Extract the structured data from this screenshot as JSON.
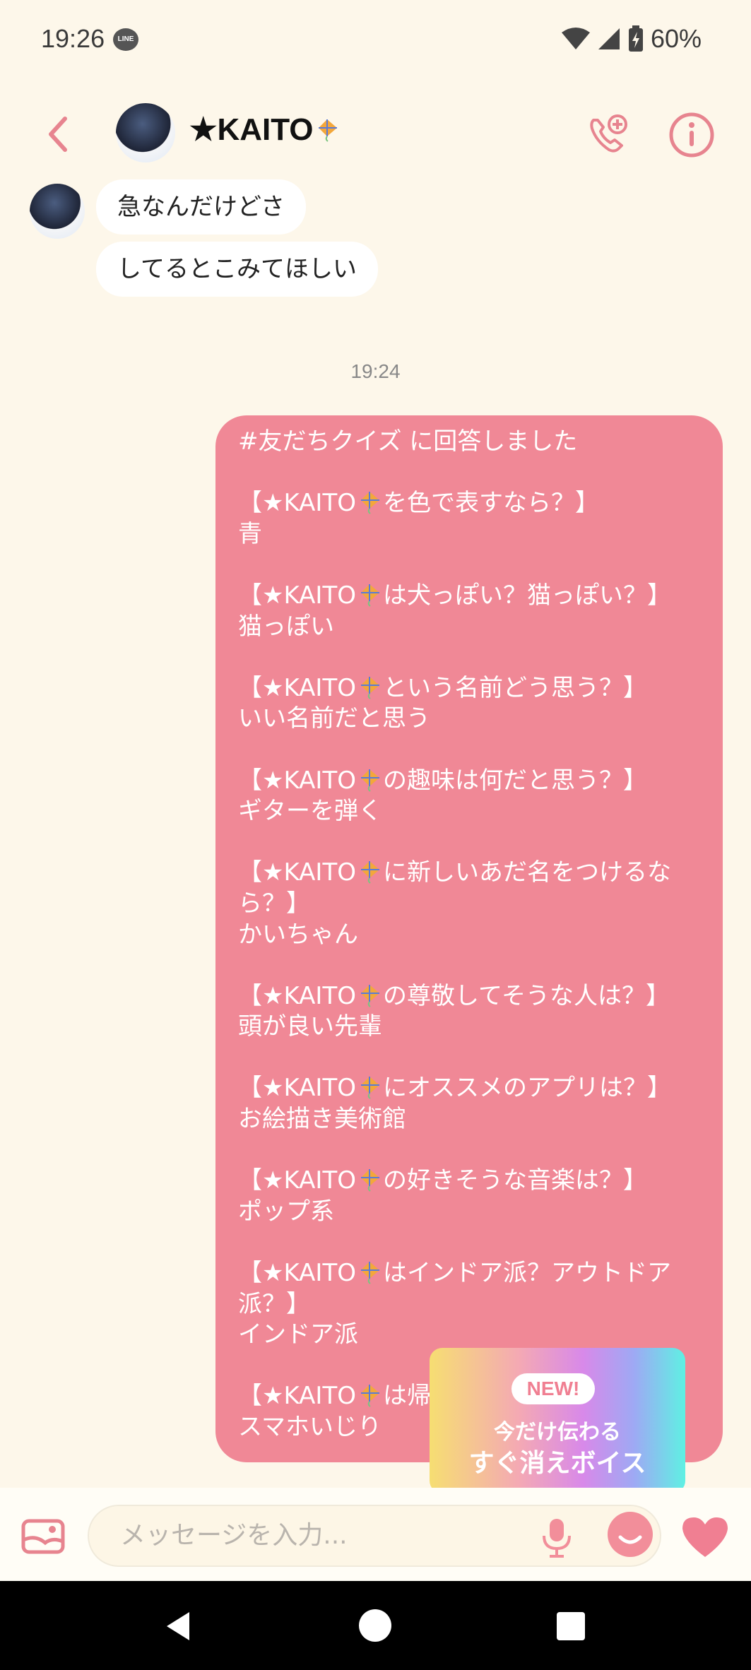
{
  "status_bar": {
    "time": "19:26",
    "app_badge": "LINE",
    "battery": "60%"
  },
  "header": {
    "contact_name": "★KAITO"
  },
  "incoming_messages": [
    "急なんだけどさ",
    "してるとこみてほしい"
  ],
  "timestamp": "19:24",
  "outgoing_message": {
    "lines": [
      "#友だちクイズ に回答しました",
      "",
      "【★KAITO{kite}を色で表すなら？】",
      "青",
      "",
      "【★KAITO{kite}は犬っぽい？猫っぽい？】",
      "猫っぽい",
      "",
      "【★KAITO{kite}という名前どう思う？】",
      "いい名前だと思う",
      "",
      "【★KAITO{kite}の趣味は何だと思う？】",
      "ギターを弾く",
      "",
      "【★KAITO{kite}に新しいあだ名をつけるな",
      "ら？】",
      "かいちゃん",
      "",
      "【★KAITO{kite}の尊敬してそうな人は？】",
      "頭が良い先輩",
      "",
      "【★KAITO{kite}にオススメのアプリは？】",
      "お絵描き美術館",
      "",
      "【★KAITO{kite}の好きそうな音楽は？】",
      "ポップ系",
      "",
      "【★KAITO{kite}はインドア派？アウトドア",
      "派？】",
      "インドア派",
      "",
      "【★KAITO{kite}は帰",
      "スマホいじり"
    ]
  },
  "promo": {
    "badge": "NEW!",
    "line1": "今だけ伝わる",
    "line2": "すぐ消えボイス"
  },
  "input": {
    "placeholder": "メッセージを入力..."
  },
  "colors": {
    "accent": "#f08896",
    "background": "#fdf7ea",
    "incoming_bubble": "#ffffff"
  },
  "icons": [
    "back-arrow-icon",
    "voice-call-icon",
    "info-icon",
    "gallery-icon",
    "mic-icon",
    "emoji-icon",
    "heart-icon",
    "kite-emoji-icon"
  ]
}
